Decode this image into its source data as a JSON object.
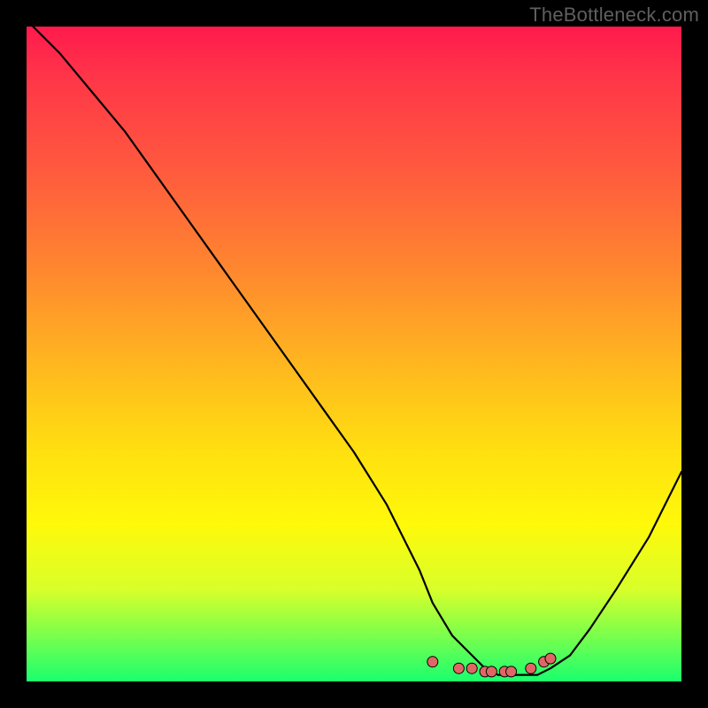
{
  "attribution": "TheBottleneck.com",
  "colors": {
    "frame_bg": "#000000",
    "attribution_text": "#5f5f5f",
    "curve_stroke": "#000000",
    "marker_fill": "#e06666",
    "marker_stroke": "#000000"
  },
  "chart_data": {
    "type": "line",
    "title": "",
    "xlabel": "",
    "ylabel": "",
    "xlim": [
      0,
      100
    ],
    "ylim": [
      0,
      100
    ],
    "gradient_meaning": "vertical color gradient from red (top, high/bad) through orange/yellow to green (bottom, low/good)",
    "series": [
      {
        "name": "bottleneck-curve",
        "x": [
          1,
          5,
          10,
          15,
          20,
          25,
          30,
          35,
          40,
          45,
          50,
          55,
          60,
          62,
          65,
          68,
          70,
          72,
          74,
          76,
          78,
          80,
          83,
          86,
          90,
          95,
          100
        ],
        "y": [
          100,
          96,
          90,
          84,
          77,
          70,
          63,
          56,
          49,
          42,
          35,
          27,
          17,
          12,
          7,
          4,
          2,
          1,
          1,
          1,
          1,
          2,
          4,
          8,
          14,
          22,
          32
        ]
      }
    ],
    "markers": {
      "name": "highlight-dots",
      "x": [
        62,
        66,
        68,
        70,
        71,
        73,
        74,
        77,
        79,
        80
      ],
      "y": [
        3,
        2,
        2,
        1.5,
        1.5,
        1.5,
        1.5,
        2,
        3,
        3.5
      ]
    }
  }
}
